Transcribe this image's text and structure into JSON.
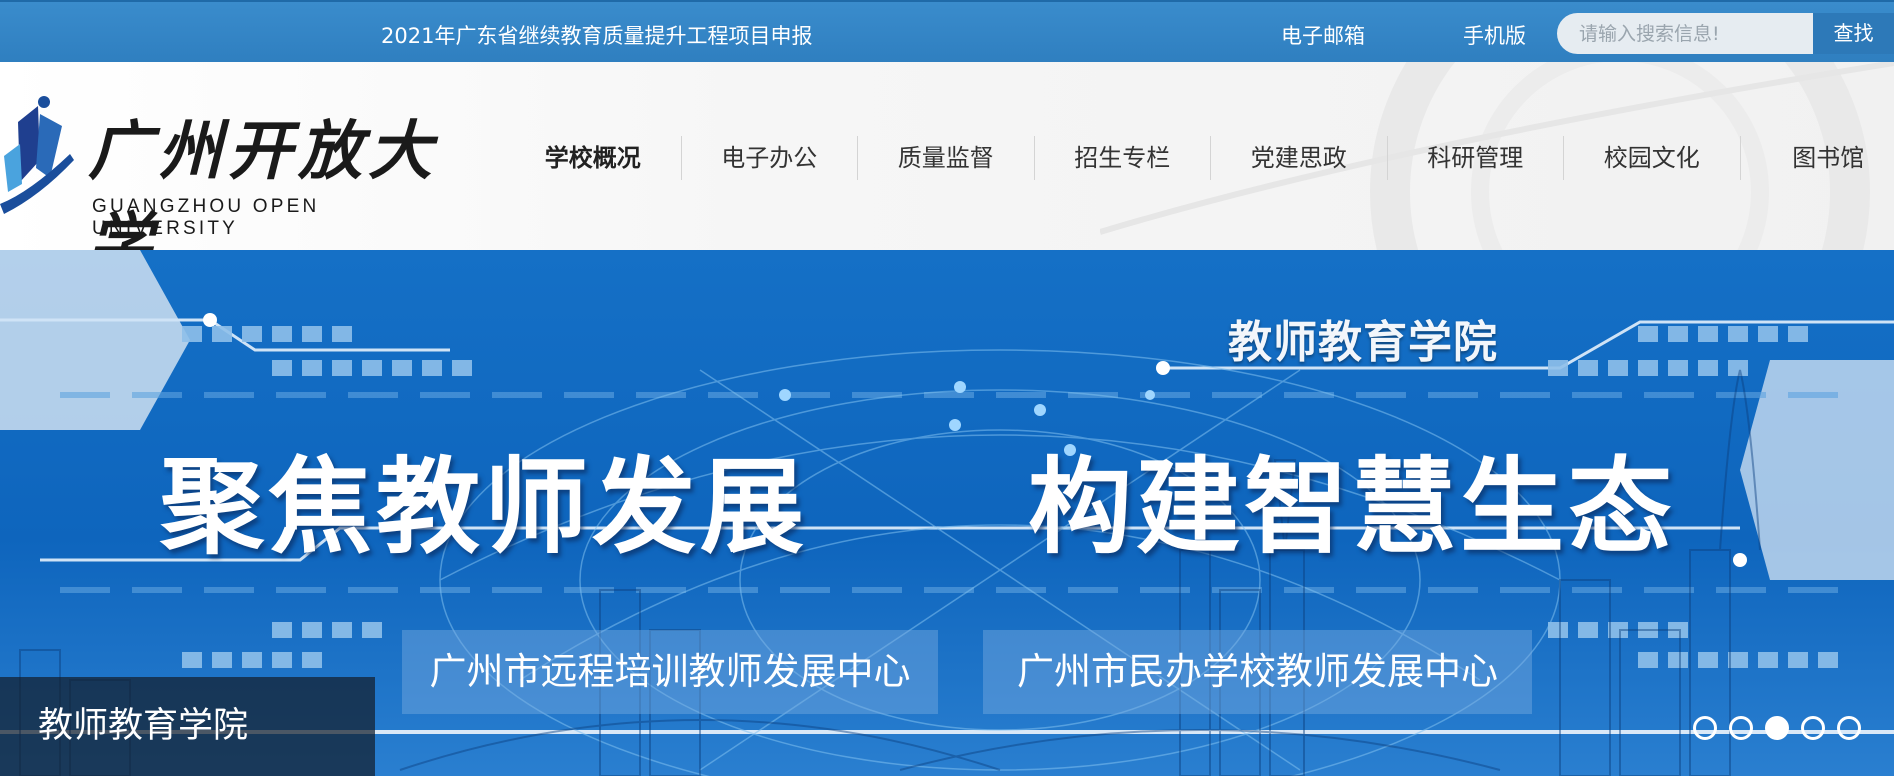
{
  "topbar": {
    "notice": "2021年广东省继续教育质量提升工程项目申报",
    "email": "电子邮箱",
    "mobile": "手机版",
    "search_placeholder": "请输入搜索信息!",
    "search_button": "查找"
  },
  "logo": {
    "name_cn": "广州开放大学",
    "name_en": "GUANGZHOU OPEN UNIVERSITY"
  },
  "nav": {
    "items": [
      {
        "label": "学校概况",
        "active": true
      },
      {
        "label": "电子办公"
      },
      {
        "label": "质量监督"
      },
      {
        "label": "招生专栏"
      },
      {
        "label": "党建思政"
      },
      {
        "label": "科研管理"
      },
      {
        "label": "校园文化"
      },
      {
        "label": "图书馆"
      }
    ]
  },
  "banner": {
    "college": "教师教育学院",
    "headline_left": "聚焦教师发展",
    "headline_right": "构建智慧生态",
    "center_one": "广州市远程培训教师发展中心",
    "center_two": "广州市民办学校教师发展中心",
    "caption": "教师教育学院",
    "slide_count": 5,
    "active_slide": 3
  },
  "colors": {
    "topbar": "#3386c8",
    "banner": "#1570c6",
    "nav_text": "#333333"
  }
}
